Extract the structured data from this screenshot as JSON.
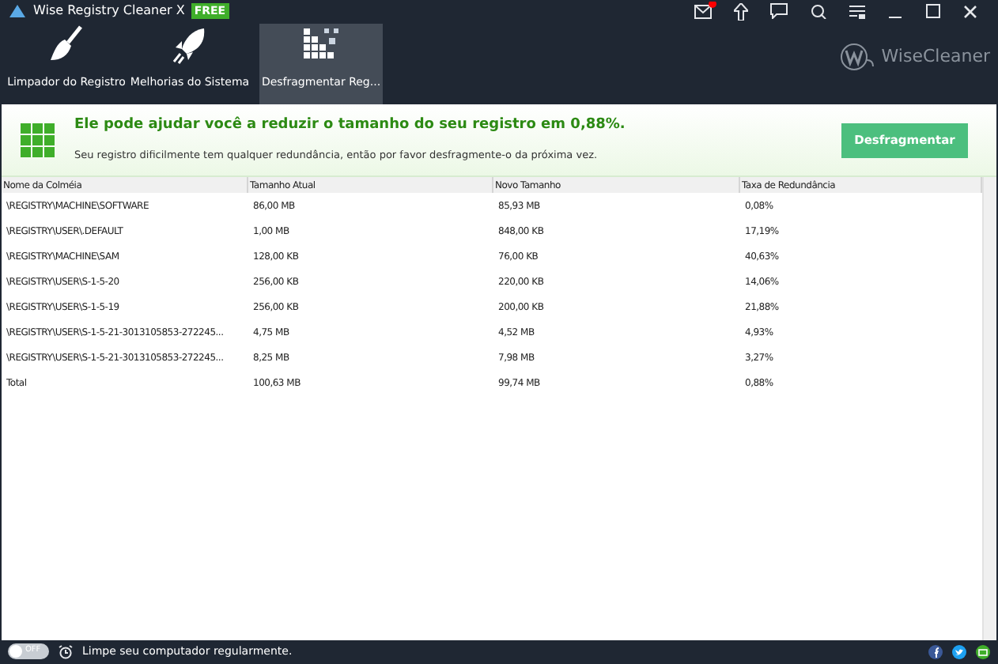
{
  "window": {
    "title": "Wise Registry Cleaner X",
    "badge": "FREE",
    "has_mail": true
  },
  "tabs": [
    {
      "label": "Limpador do Registro",
      "kind": "broom",
      "selected": false
    },
    {
      "label": "Melhorias do Sistema",
      "kind": "rocket",
      "selected": false
    },
    {
      "label": "Desfragmentar Reg...",
      "kind": "blocks",
      "selected": true
    }
  ],
  "brand": "WiseCleaner",
  "banner": {
    "headline": "Ele pode ajudar você a reduzir o tamanho do seu registro em 0,88%.",
    "subtext": "Seu registro dificilmente tem qualquer redundância, então por favor desfragmente-o da próxima vez.",
    "button": "Desfragmentar"
  },
  "table": {
    "columns": [
      "Nome da Colméia",
      "Tamanho Atual",
      "Novo Tamanho",
      "Taxa de Redundância"
    ],
    "rows": [
      [
        "\\REGISTRY\\MACHINE\\SOFTWARE",
        "86,00 MB",
        "85,93 MB",
        "0,08%"
      ],
      [
        "\\REGISTRY\\USER\\.DEFAULT",
        "1,00 MB",
        "848,00 KB",
        "17,19%"
      ],
      [
        "\\REGISTRY\\MACHINE\\SAM",
        "128,00 KB",
        "76,00 KB",
        "40,63%"
      ],
      [
        "\\REGISTRY\\USER\\S-1-5-20",
        "256,00 KB",
        "220,00 KB",
        "14,06%"
      ],
      [
        "\\REGISTRY\\USER\\S-1-5-19",
        "256,00 KB",
        "200,00 KB",
        "21,88%"
      ],
      [
        "\\REGISTRY\\USER\\S-1-5-21-3013105853-272245...",
        "4,75 MB",
        "4,52 MB",
        "4,93%"
      ],
      [
        "\\REGISTRY\\USER\\S-1-5-21-3013105853-272245...",
        "8,25 MB",
        "7,98 MB",
        "3,27%"
      ],
      [
        "Total",
        "100,63 MB",
        "99,74 MB",
        "0,88%"
      ]
    ]
  },
  "footer": {
    "toggle": {
      "label": "OFF",
      "on": false
    },
    "text": "Limpe seu computador regularmente."
  }
}
